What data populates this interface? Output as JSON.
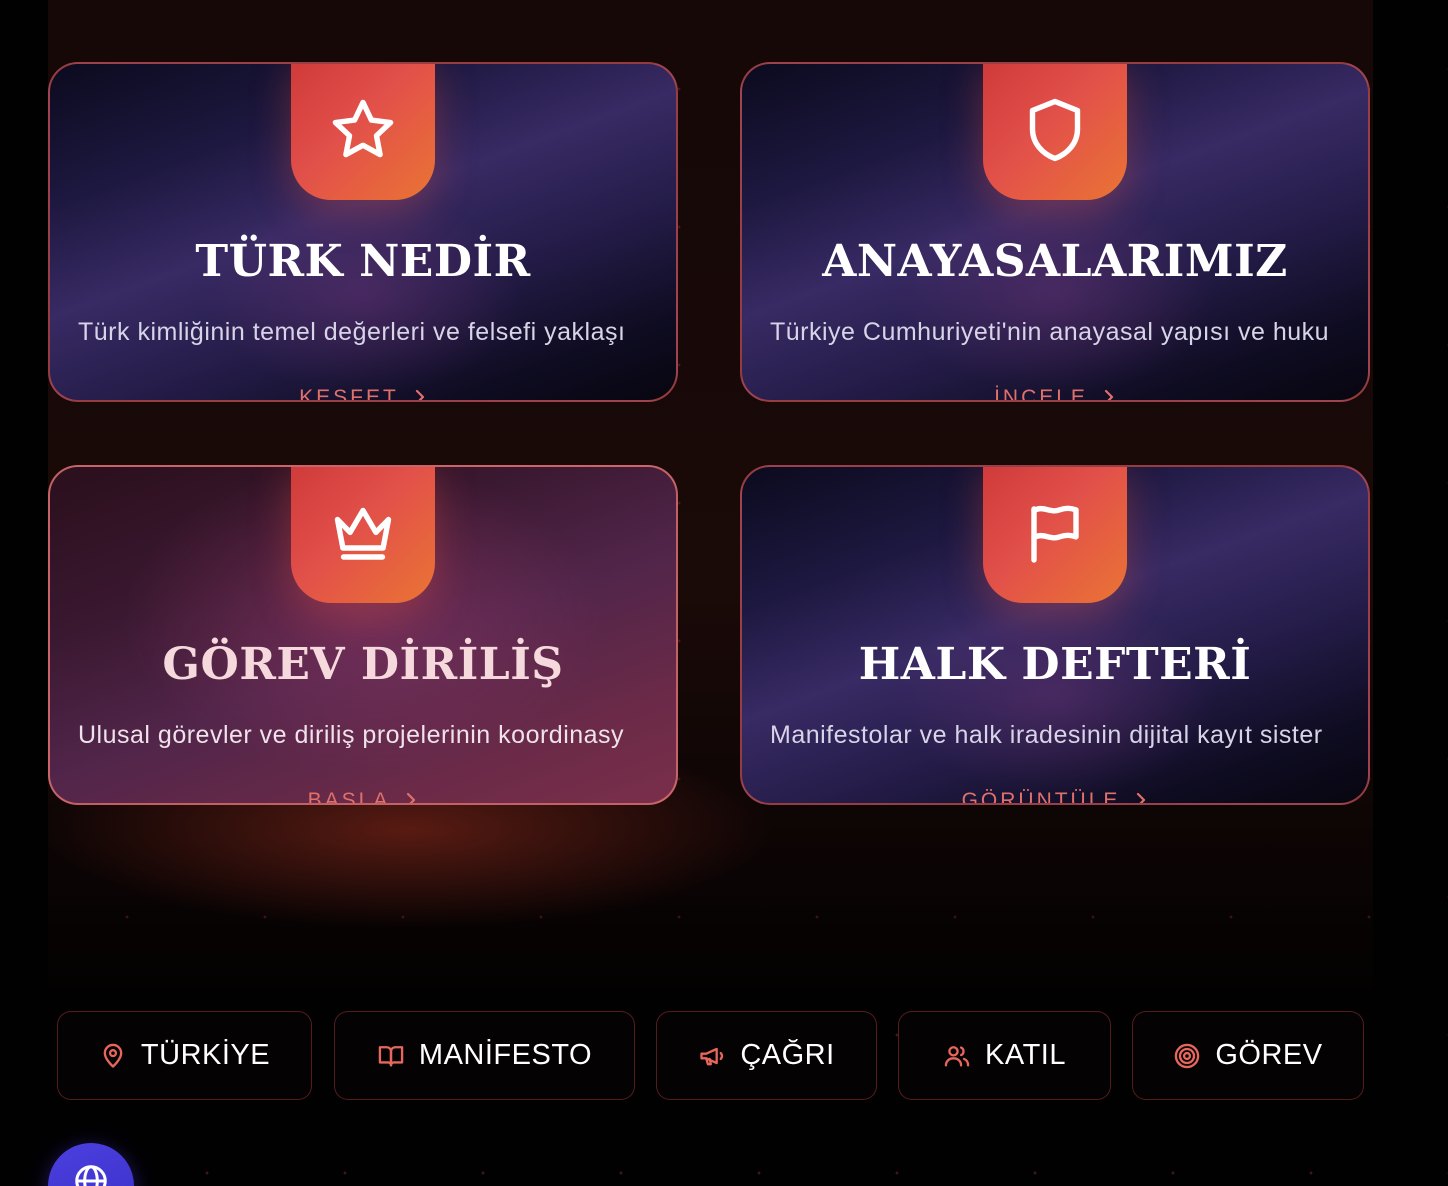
{
  "cards": [
    {
      "title": "TÜRK NEDİR",
      "description": "Türk kimliğinin temel değerleri ve felsefi yaklaşı",
      "action": "KEŞFET",
      "icon": "star-icon"
    },
    {
      "title": "ANAYASALARIMIZ",
      "description": "Türkiye Cumhuriyeti'nin anayasal yapısı ve huku",
      "action": "İNCELE",
      "icon": "shield-icon"
    },
    {
      "title": "GÖREV DİRİLİŞ",
      "description": "Ulusal görevler ve diriliş projelerinin koordinasy",
      "action": "BAŞLA",
      "icon": "crown-icon"
    },
    {
      "title": "HALK DEFTERİ",
      "description": "Manifestolar ve halk iradesinin dijital kayıt sister",
      "action": "GÖRÜNTÜLE",
      "icon": "flag-icon"
    }
  ],
  "nav": [
    {
      "label": "TÜRKİYE",
      "icon": "map-pin-icon"
    },
    {
      "label": "MANİFESTO",
      "icon": "book-icon"
    },
    {
      "label": "ÇAĞRI",
      "icon": "megaphone-icon"
    },
    {
      "label": "KATIL",
      "icon": "users-icon"
    },
    {
      "label": "GÖREV",
      "icon": "target-icon"
    }
  ],
  "floating_button": {
    "icon": "globe-icon"
  },
  "colors": {
    "accent": "#e2504a",
    "accent_orange": "#ea7434",
    "card_border": "#c44e4e",
    "action_text": "#e0706a",
    "globe_button": "#4b3fe0"
  }
}
